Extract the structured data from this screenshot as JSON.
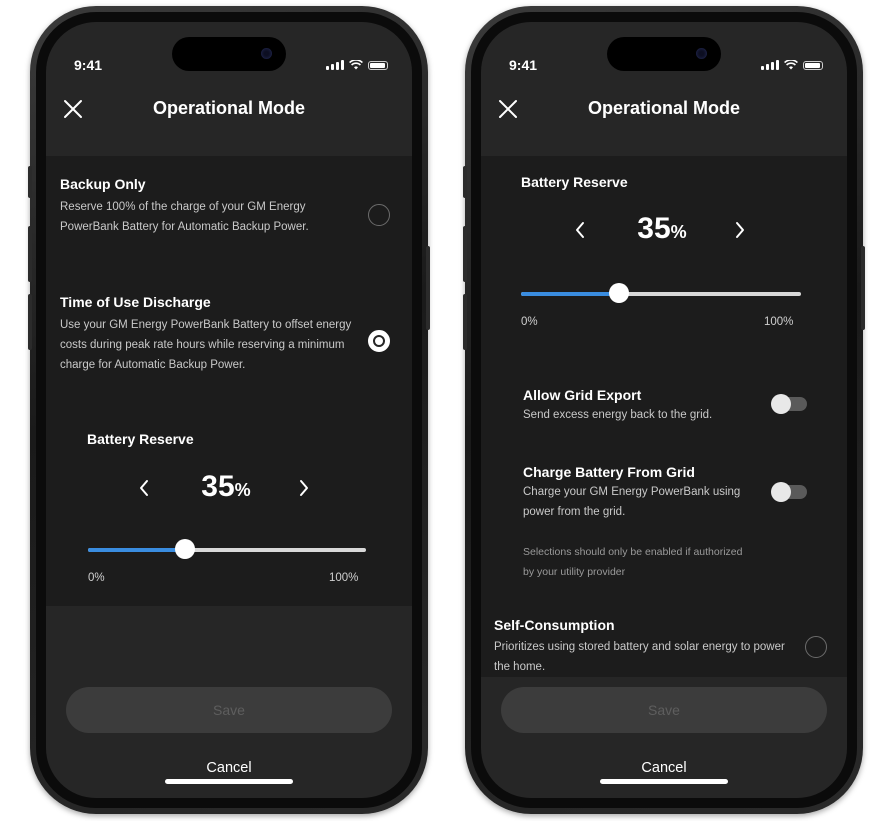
{
  "screens": [
    {
      "time": "9:41",
      "title": "Operational Mode",
      "backup_only": {
        "label": "Backup Only",
        "description": "Reserve 100% of the charge of your GM Energy PowerBank Battery for Automatic Backup Power.",
        "selected": false
      },
      "tou": {
        "label": "Time of Use Discharge",
        "description": "Use your GM Energy PowerBank Battery to offset energy costs during peak rate hours while reserving a minimum charge for Automatic Backup Power.",
        "selected": true
      },
      "reserve": {
        "label": "Battery Reserve",
        "value": "35",
        "unit": "%",
        "fraction": 0.35,
        "min_label": "0%",
        "max_label": "100%"
      },
      "save_label": "Save",
      "cancel_label": "Cancel"
    },
    {
      "time": "9:41",
      "title": "Operational Mode",
      "reserve": {
        "label": "Battery Reserve",
        "value": "35",
        "unit": "%",
        "fraction": 0.35,
        "min_label": "0%",
        "max_label": "100%"
      },
      "grid_export": {
        "label": "Allow Grid Export",
        "description": "Send excess energy back to the grid.",
        "enabled": false
      },
      "charge_from_grid": {
        "label": "Charge Battery From Grid",
        "description": "Charge your GM Energy PowerBank using power from the grid.",
        "enabled": false
      },
      "note": "Selections should only be enabled if authorized by your utility provider",
      "self_consumption": {
        "label": "Self-Consumption",
        "description": "Prioritizes using stored battery and solar energy to power the home.",
        "selected": false
      },
      "save_label": "Save",
      "cancel_label": "Cancel"
    }
  ],
  "colors": {
    "accent": "#3a8de0",
    "screen_bg": "#262626",
    "panel_bg": "#1c1c1c",
    "save_disabled_bg": "#3c3c3c"
  },
  "icons": [
    "close-icon",
    "chevron-left-icon",
    "chevron-right-icon",
    "signal-icon",
    "wifi-icon",
    "battery-icon"
  ]
}
